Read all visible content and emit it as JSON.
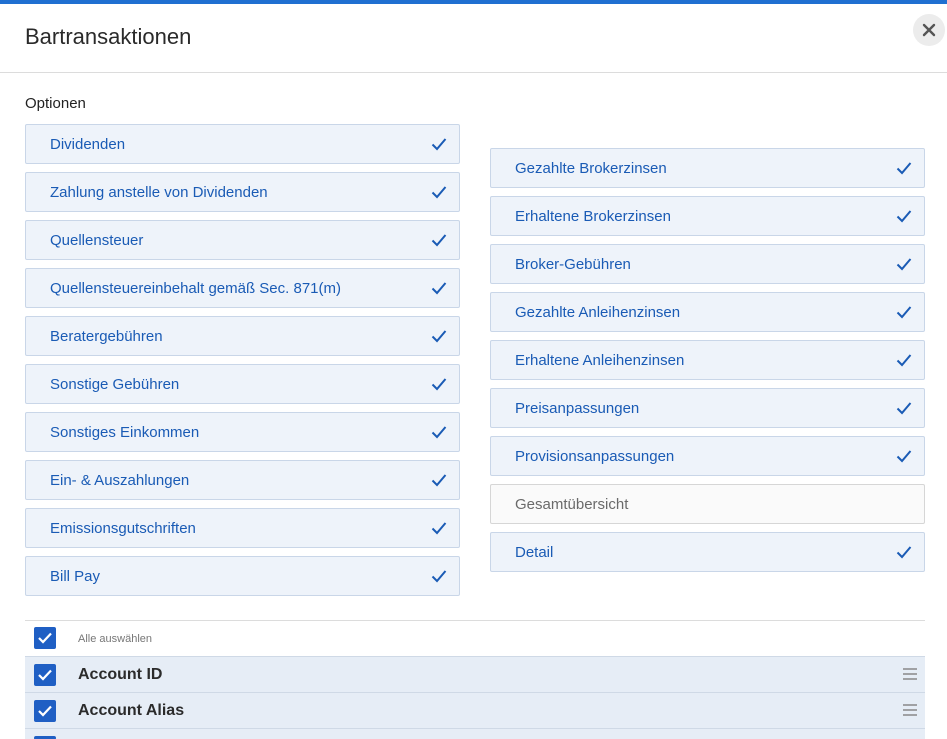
{
  "dialog": {
    "title": "Bartransaktionen",
    "close_icon": "close-icon",
    "accent_color": "#1f6fd1"
  },
  "options": {
    "label": "Optionen",
    "left": [
      {
        "label": "Dividenden",
        "checked": true
      },
      {
        "label": "Zahlung anstelle von Dividenden",
        "checked": true
      },
      {
        "label": "Quellensteuer",
        "checked": true
      },
      {
        "label": "Quellensteuereinbehalt gemäß Sec. 871(m)",
        "checked": true
      },
      {
        "label": "Beratergebühren",
        "checked": true
      },
      {
        "label": "Sonstige Gebühren",
        "checked": true
      },
      {
        "label": "Sonstiges Einkommen",
        "checked": true
      },
      {
        "label": "Ein- & Auszahlungen",
        "checked": true
      },
      {
        "label": "Emissionsgutschriften",
        "checked": true
      },
      {
        "label": "Bill Pay",
        "checked": true
      }
    ],
    "right": [
      {
        "label": "Gezahlte Brokerzinsen",
        "checked": true
      },
      {
        "label": "Erhaltene Brokerzinsen",
        "checked": true
      },
      {
        "label": "Broker-Gebühren",
        "checked": true
      },
      {
        "label": "Gezahlte Anleihenzinsen",
        "checked": true
      },
      {
        "label": "Erhaltene Anleihenzinsen",
        "checked": true
      },
      {
        "label": "Preisanpassungen",
        "checked": true
      },
      {
        "label": "Provisionsanpassungen",
        "checked": true
      },
      {
        "label": "Gesamtübersicht",
        "checked": false
      },
      {
        "label": "Detail",
        "checked": true
      }
    ]
  },
  "fields": {
    "select_all_label": "Alle auswählen",
    "select_all_checked": true,
    "rows": [
      {
        "label": "Account ID",
        "checked": true
      },
      {
        "label": "Account Alias",
        "checked": true
      }
    ]
  }
}
